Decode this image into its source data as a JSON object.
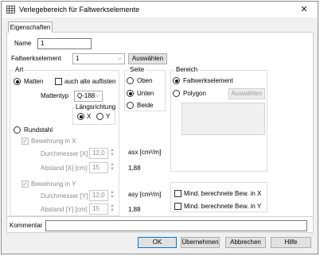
{
  "window": {
    "title": "Verlegebereich für Faltwerkselemente",
    "close_label": "✕"
  },
  "tabs": [
    {
      "label": "Eigenschaften"
    }
  ],
  "name": {
    "label": "Name",
    "value": "1"
  },
  "faltwerkselement": {
    "label": "Faltwerkselement",
    "value": "1",
    "button": "Auswählen"
  },
  "art": {
    "title": "Art",
    "matten_label": "Matten",
    "alte_label": "auch alte auflisten",
    "mattentyp_label": "Mattentyp",
    "mattentyp_value": "Q-188",
    "laengsrichtung_title": "Längsrichtung",
    "x_label": "X",
    "y_label": "Y",
    "rundstahl_label": "Rundstahl",
    "bew_x_label": "Bewehrung in X",
    "durchmesser_x_label": "Durchmesser [X] [mm]",
    "durchmesser_x_value": "12,0",
    "abstand_x_label": "Abstand [X] [cm]",
    "abstand_x_value": "15",
    "bew_y_label": "Bewehrung in Y",
    "durchmesser_y_label": "Durchmesser [Y] [mm]",
    "durchmesser_y_value": "12,0",
    "abstand_y_label": "Abstand [Y] [cm]",
    "abstand_y_value": "15"
  },
  "seite": {
    "title": "Seite",
    "oben": "Oben",
    "unten": "Unten",
    "beide": "Beide"
  },
  "asx": {
    "label": "asx [cm²/m]",
    "value": "1,88"
  },
  "asy": {
    "label": "asy [cm²/m]",
    "value": "1,88"
  },
  "bereich": {
    "title": "Bereich",
    "faltwerkselement": "Faltwerkselement",
    "polygon": "Polygon",
    "auswaehlen": "Auswählen"
  },
  "mind_x": "Mind. berechnete Bew. in X",
  "mind_y": "Mind. berechnete Bew. in Y",
  "kommentar": {
    "label": "Kommentar",
    "value": ""
  },
  "footer": {
    "ok": "OK",
    "uebernehmen": "Übernehmen",
    "abbrechen": "Abbrechen",
    "hilfe": "Hilfe"
  }
}
